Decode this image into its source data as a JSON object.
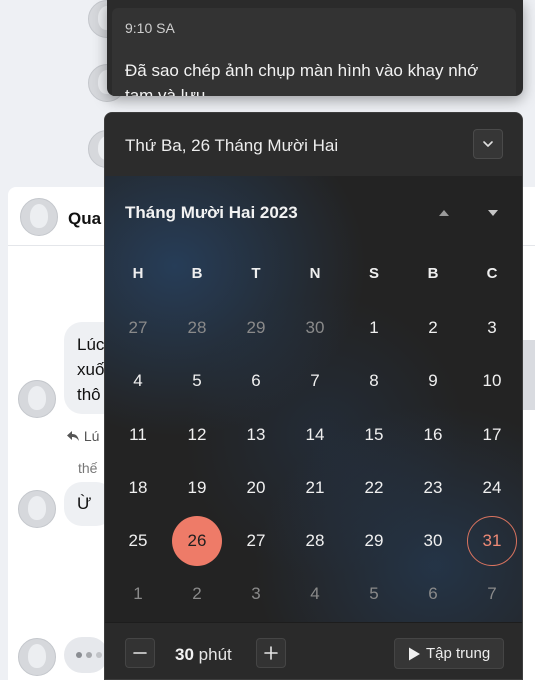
{
  "background": {
    "chat_title": "Qua",
    "bubble_lines": [
      "Lúc",
      "xuố",
      "thô"
    ],
    "reply_label": "Lú",
    "small_text": "thế",
    "bubble2_text": "Ừ"
  },
  "toast": {
    "time": "9:10 SA",
    "message": "Đã sao chép ảnh chụp màn hình vào khay nhớ tạm và lưu"
  },
  "calendar": {
    "date_header": "Thứ Ba, 26 Tháng Mười Hai",
    "collapse_icon": "chevron-down-icon",
    "month_label": "Tháng Mười Hai 2023",
    "weekdays": [
      "H",
      "B",
      "T",
      "N",
      "S",
      "B",
      "C"
    ],
    "weeks": [
      [
        {
          "d": "27",
          "muted": true
        },
        {
          "d": "28",
          "muted": true
        },
        {
          "d": "29",
          "muted": true
        },
        {
          "d": "30",
          "muted": true
        },
        {
          "d": "1"
        },
        {
          "d": "2"
        },
        {
          "d": "3"
        }
      ],
      [
        {
          "d": "4"
        },
        {
          "d": "5"
        },
        {
          "d": "6"
        },
        {
          "d": "7"
        },
        {
          "d": "8"
        },
        {
          "d": "9"
        },
        {
          "d": "10"
        }
      ],
      [
        {
          "d": "11"
        },
        {
          "d": "12"
        },
        {
          "d": "13"
        },
        {
          "d": "14"
        },
        {
          "d": "15"
        },
        {
          "d": "16"
        },
        {
          "d": "17"
        }
      ],
      [
        {
          "d": "18"
        },
        {
          "d": "19"
        },
        {
          "d": "20"
        },
        {
          "d": "21"
        },
        {
          "d": "22"
        },
        {
          "d": "23"
        },
        {
          "d": "24"
        }
      ],
      [
        {
          "d": "25"
        },
        {
          "d": "26",
          "selected": true
        },
        {
          "d": "27"
        },
        {
          "d": "28"
        },
        {
          "d": "29"
        },
        {
          "d": "30"
        },
        {
          "d": "31",
          "today": true
        }
      ],
      [
        {
          "d": "1",
          "muted": true
        },
        {
          "d": "2",
          "muted": true
        },
        {
          "d": "3",
          "muted": true
        },
        {
          "d": "4",
          "muted": true
        },
        {
          "d": "5",
          "muted": true
        },
        {
          "d": "6",
          "muted": true
        },
        {
          "d": "7",
          "muted": true
        }
      ]
    ],
    "selected_color": "#ee7b68",
    "today_color": "#d9735f"
  },
  "focus": {
    "minutes_value": "30",
    "minutes_unit": "phút",
    "focus_button_label": "Tập trung"
  }
}
